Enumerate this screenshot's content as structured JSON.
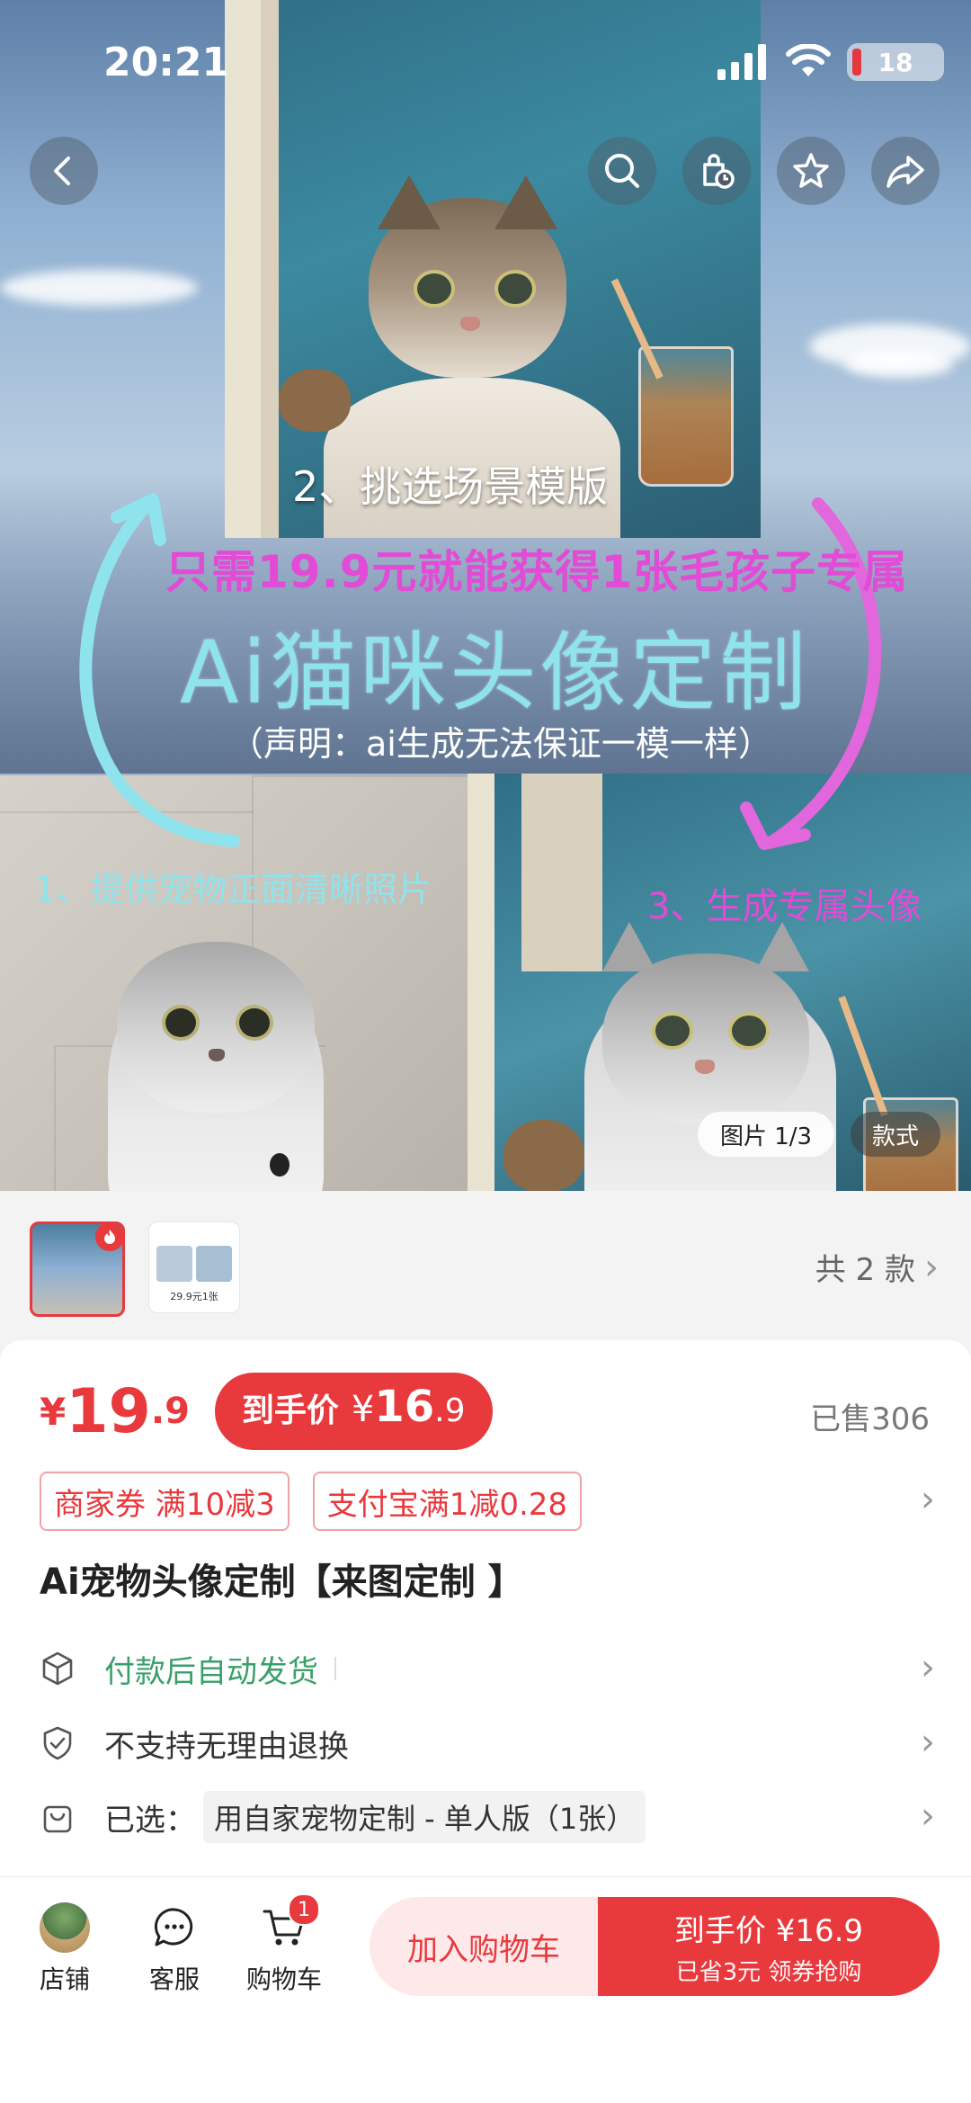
{
  "status_bar": {
    "time": "20:21",
    "battery": "18"
  },
  "hero": {
    "step2": "2、挑选场景模版",
    "headline": "只需19.9元就能获得1张毛孩子专属",
    "title": "Ai猫咪头像定制",
    "note": "（声明：ai生成无法保证一模一样）",
    "step1": "1、提供宠物正面清晰照片",
    "step3": "3、生成专属头像",
    "image_counter": "图片 1/3",
    "style_tab": "款式"
  },
  "variants": {
    "count_label": "共 2 款",
    "thumb2_caption": "29.9元1张"
  },
  "price": {
    "yen": "¥",
    "int": "19",
    "dec": ".9",
    "final_label": "到手价",
    "final_yen": "¥",
    "final_int": "16",
    "final_dec": ".9",
    "sold": "已售306"
  },
  "coupons": [
    "商家券 满10减3",
    "支付宝满1减0.28"
  ],
  "product_title": "Ai宠物头像定制【来图定制 】",
  "services": [
    {
      "icon": "box-icon",
      "text": "付款后自动发货"
    },
    {
      "icon": "shield-check-icon",
      "text": "不支持无理由退换"
    },
    {
      "icon": "bag-icon",
      "label": "已选：",
      "text": "用自家宠物定制 - 单人版（1张）"
    }
  ],
  "bottom_nav": {
    "shop": "店铺",
    "service": "客服",
    "cart": "购物车",
    "cart_badge": "1",
    "add_cart": "加入购物车",
    "buy_main": "到手价 ¥16.9",
    "buy_sub": "已省3元 领券抢购"
  },
  "colors": {
    "accent": "#e8393d",
    "service_green": "#3aa06a",
    "cyan_text": "#8fe3ec",
    "magenta_text": "#e24bd6"
  }
}
